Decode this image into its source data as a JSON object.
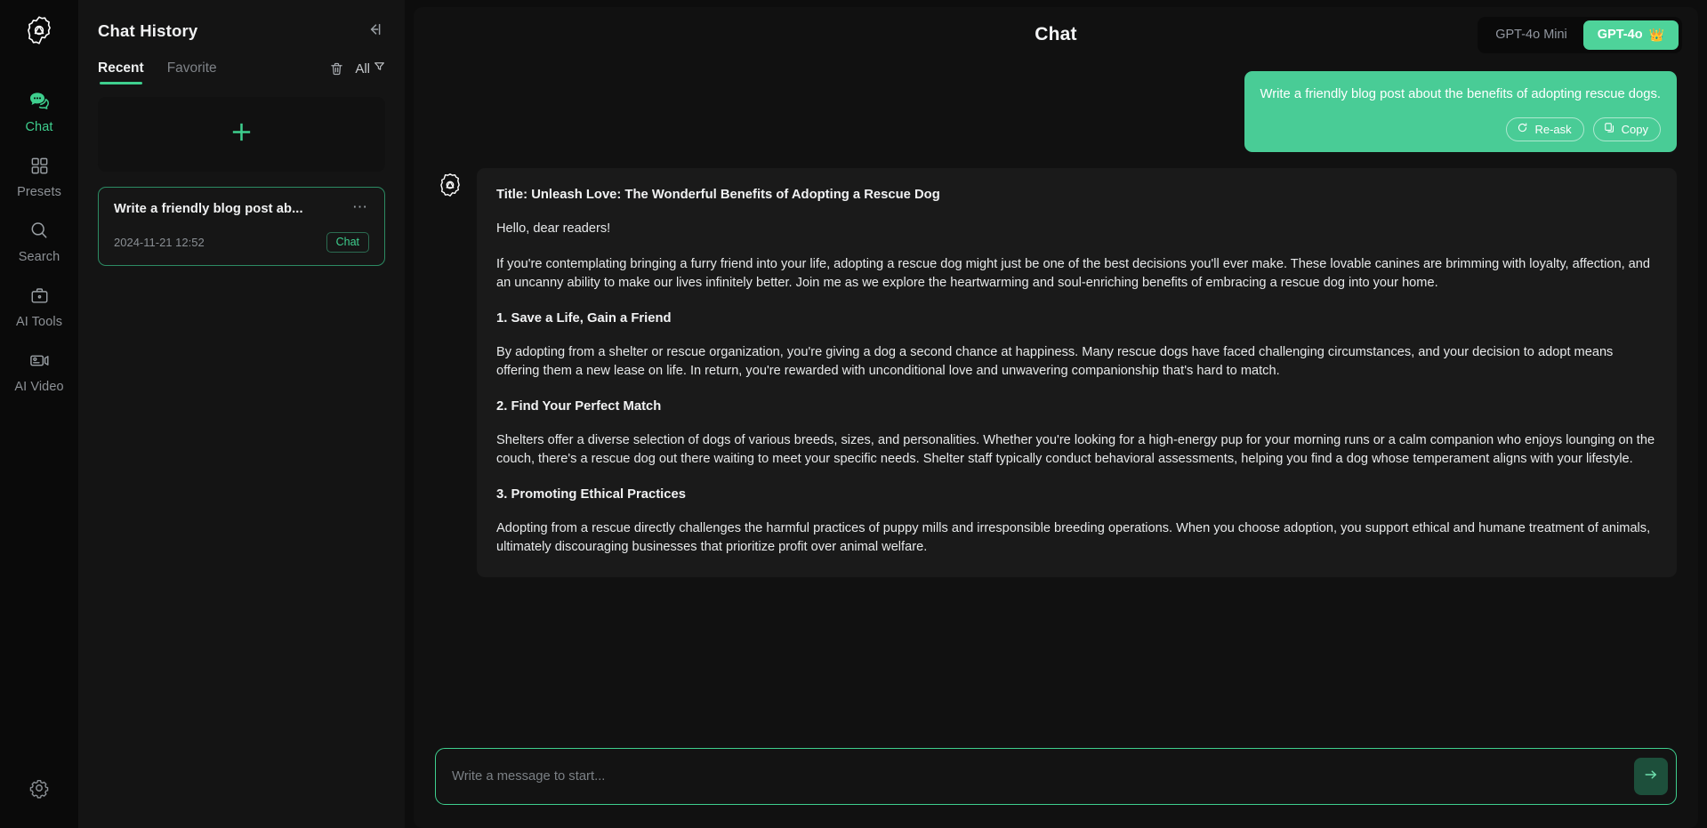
{
  "brand": {
    "accent": "#3ecf8e",
    "accent_button": "#4ed39a",
    "user_bubble": "#49cc96"
  },
  "rail": {
    "logo_icon": "app-logo-icon",
    "items": [
      {
        "label": "Chat",
        "icon": "chat-bubble-icon",
        "active": true
      },
      {
        "label": "Presets",
        "icon": "grid-squares-icon",
        "active": false
      },
      {
        "label": "Search",
        "icon": "magnifier-icon",
        "active": false
      },
      {
        "label": "AI Tools",
        "icon": "briefcase-icon",
        "active": false
      },
      {
        "label": "AI Video",
        "icon": "video-camera-icon",
        "active": false
      }
    ],
    "settings_icon": "gear-icon"
  },
  "history": {
    "title": "Chat History",
    "collapse_icon": "collapse-panel-icon",
    "tabs": [
      {
        "label": "Recent",
        "active": true
      },
      {
        "label": "Favorite",
        "active": false
      }
    ],
    "trash_icon": "trash-icon",
    "filter": {
      "label": "All",
      "icon": "filter-icon"
    },
    "new_chat": {
      "icon": "plus-icon",
      "label": ""
    },
    "items": [
      {
        "title": "Write a friendly blog post ab...",
        "date": "2024-11-21 12:52",
        "badge": "Chat",
        "more_icon": "ellipsis-icon",
        "selected": true
      }
    ]
  },
  "header": {
    "title": "Chat",
    "models": [
      {
        "label": "GPT-4o Mini",
        "active": false,
        "badge": ""
      },
      {
        "label": "GPT-4o",
        "active": true,
        "badge": "👑"
      }
    ]
  },
  "conversation": {
    "user": {
      "text": "Write a friendly blog post about the benefits of adopting rescue dogs.",
      "actions": [
        {
          "label": "Re-ask",
          "icon": "refresh-icon"
        },
        {
          "label": "Copy",
          "icon": "copy-icon"
        }
      ]
    },
    "assistant": {
      "avatar_icon": "assistant-logo-icon",
      "blocks": [
        {
          "type": "heading",
          "text": "Title: Unleash Love: The Wonderful Benefits of Adopting a Rescue Dog"
        },
        {
          "type": "paragraph",
          "text": "Hello, dear readers!"
        },
        {
          "type": "paragraph",
          "text": "If you're contemplating bringing a furry friend into your life, adopting a rescue dog might just be one of the best decisions you'll ever make. These lovable canines are brimming with loyalty, affection, and an uncanny ability to make our lives infinitely better. Join me as we explore the heartwarming and soul-enriching benefits of embracing a rescue dog into your home."
        },
        {
          "type": "heading",
          "text": "1. Save a Life, Gain a Friend"
        },
        {
          "type": "paragraph",
          "text": "By adopting from a shelter or rescue organization, you're giving a dog a second chance at happiness. Many rescue dogs have faced challenging circumstances, and your decision to adopt means offering them a new lease on life. In return, you're rewarded with unconditional love and unwavering companionship that's hard to match."
        },
        {
          "type": "heading",
          "text": "2. Find Your Perfect Match"
        },
        {
          "type": "paragraph",
          "text": "Shelters offer a diverse selection of dogs of various breeds, sizes, and personalities. Whether you're looking for a high-energy pup for your morning runs or a calm companion who enjoys lounging on the couch, there's a rescue dog out there waiting to meet your specific needs. Shelter staff typically conduct behavioral assessments, helping you find a dog whose temperament aligns with your lifestyle."
        },
        {
          "type": "heading",
          "text": "3. Promoting Ethical Practices"
        },
        {
          "type": "paragraph",
          "text": "Adopting from a rescue directly challenges the harmful practices of puppy mills and irresponsible breeding operations. When you choose adoption, you support ethical and humane treatment of animals, ultimately discouraging businesses that prioritize profit over animal welfare."
        }
      ]
    }
  },
  "composer": {
    "value": "",
    "placeholder": "Write a message to start...",
    "send_icon": "arrow-right-icon"
  }
}
